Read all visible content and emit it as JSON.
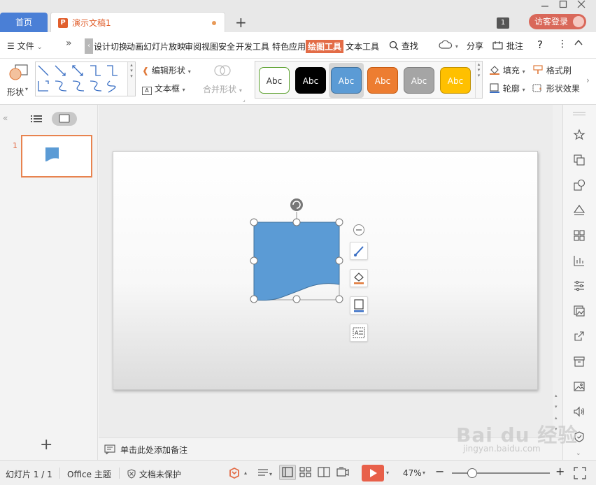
{
  "titlebar": {
    "home_tab": "首页",
    "doc_tab": "演示文稿1",
    "doc_icon_letter": "P",
    "new_tab_symbol": "+",
    "window_count": "1",
    "login_label": "访客登录"
  },
  "menu": {
    "file_label": "文件",
    "more_chevron": "»",
    "scroll_left": "‹",
    "tabs": [
      "设计",
      "切换",
      "动画",
      "幻灯片放映",
      "审阅",
      "视图",
      "安全",
      "开发工具",
      "特色应用",
      "绘图工具",
      "文本工具"
    ],
    "active_tab": "绘图工具",
    "search_label": "查找",
    "share_label": "分享",
    "comment_label": "批注",
    "help_symbol": "?",
    "more_symbol": "⋮",
    "collapse_symbol": "^"
  },
  "ribbon": {
    "shape_label": "形状",
    "edit_shape_label": "编辑形状",
    "textbox_label": "文本框",
    "merge_shape_label": "合并形状",
    "style_samples": [
      {
        "label": "Abc",
        "fill": "#ffffff",
        "border": "#5aa02c",
        "text_color": "#333333"
      },
      {
        "label": "Abc",
        "fill": "#000000",
        "border": "#000000",
        "text_color": "#ffffff"
      },
      {
        "label": "Abc",
        "fill": "#5b9bd5",
        "border": "#41719c",
        "text_color": "#ffffff"
      },
      {
        "label": "Abc",
        "fill": "#ed7d31",
        "border": "#c55a11",
        "text_color": "#ffffff"
      },
      {
        "label": "Abc",
        "fill": "#a5a5a5",
        "border": "#7f7f7f",
        "text_color": "#ffffff"
      },
      {
        "label": "Abc",
        "fill": "#ffc000",
        "border": "#bf9000",
        "text_color": "#ffffff"
      }
    ],
    "fill_label": "填充",
    "outline_label": "轮廓",
    "format_painter_label": "格式刷",
    "shape_effect_label": "形状效果"
  },
  "slides_panel": {
    "slide_number": "1",
    "add_symbol": "+"
  },
  "notes": {
    "placeholder": "单击此处添加备注"
  },
  "status": {
    "slide_info": "幻灯片 1 / 1",
    "theme": "Office 主题",
    "protection": "文档未保护",
    "zoom": "47%",
    "zoom_minus": "−",
    "zoom_plus": "+",
    "zoom_fraction": 0.47
  },
  "watermark": {
    "text": "Bai du 经验",
    "sub": "jingyan.baidu.com"
  },
  "colors": {
    "accent": "#e36c47",
    "shape_fill": "#5b9bd5",
    "home_tab": "#4a7fd6"
  }
}
